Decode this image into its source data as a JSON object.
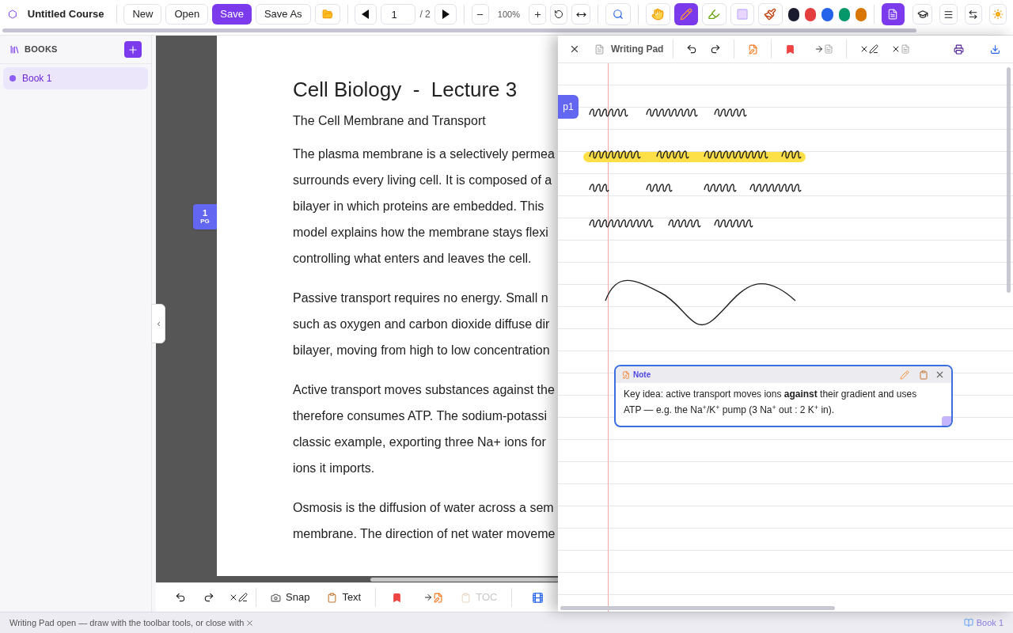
{
  "toolbar": {
    "app_title": "Untitled Course",
    "file_buttons": [
      {
        "label": "New",
        "selected": false
      },
      {
        "label": "Open",
        "selected": false
      },
      {
        "label": "Save",
        "selected": true
      },
      {
        "label": "Save As",
        "selected": false
      }
    ],
    "page_input": "1",
    "page_total": "/ 2",
    "zoom": "100%",
    "tools": [
      {
        "kind": "hand",
        "selected": false
      },
      {
        "kind": "pen",
        "selected": true
      },
      {
        "kind": "highlighter",
        "selected": false
      },
      {
        "kind": "eraser",
        "selected": false
      },
      {
        "kind": "brush",
        "selected": false
      }
    ],
    "colors": [
      {
        "color": "#1a1b2e"
      },
      {
        "color": "#e53e3e"
      },
      {
        "color": "#2563eb"
      },
      {
        "color": "#059669"
      },
      {
        "color": "#d97706"
      }
    ],
    "writing_pad_button": {
      "selected": true
    }
  },
  "sidebar": {
    "title": "BOOKS",
    "items": [
      {
        "label": "Book 1",
        "selected": true
      }
    ]
  },
  "document": {
    "page_badge": {
      "number": "1",
      "label": "PG"
    },
    "title": "Cell Biology  -  Lecture 3",
    "subtitle": "The Cell Membrane and Transport",
    "paragraphs": [
      [
        "The plasma membrane is a selectively permea",
        "surrounds every living cell. It is composed of a",
        "bilayer in which proteins are embedded. This",
        "model explains how the membrane stays flexi",
        "controlling what enters and leaves the cell."
      ],
      [
        "Passive transport requires no energy. Small n",
        "such as oxygen and carbon dioxide diffuse dir",
        "bilayer, moving from high to low concentration"
      ],
      [
        "Active transport moves substances against the",
        "therefore consumes ATP. The sodium-potassi",
        "classic example, exporting three Na+ ions for",
        "ions it imports."
      ],
      [
        "Osmosis is the diffusion of water across a sem",
        "membrane. The direction of net water moveme"
      ]
    ]
  },
  "doc_toolbar": {
    "snap": "Snap",
    "text": "Text",
    "toc": {
      "label": "TOC",
      "disabled": true
    }
  },
  "writing_pad": {
    "title": "Writing Pad",
    "page_tab": "p1",
    "note": {
      "title": "Note",
      "body": "Key idea: active transport moves ions **against** their gradient and uses ATP — e.g. the Na$^{+}$/K$^{+}$ pump (3 Na$^{+}$ out : 2 K$^{+}$ in)."
    }
  },
  "status_bar": {
    "message": "Writing Pad open — draw with the toolbar tools, or close with",
    "book": "Book 1"
  }
}
